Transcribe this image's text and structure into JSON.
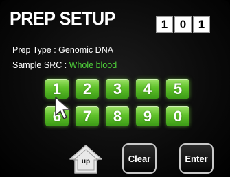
{
  "header": {
    "title": "PREP SETUP",
    "counter": [
      "1",
      "0",
      "1"
    ]
  },
  "info": {
    "prep_type_label": "Prep Type : ",
    "prep_type_value": "Genomic DNA",
    "sample_src_label": "Sample SRC : ",
    "sample_src_value": "Whole blood"
  },
  "keypad": {
    "keys": [
      "1",
      "2",
      "3",
      "4",
      "5",
      "6",
      "7",
      "8",
      "9",
      "0"
    ]
  },
  "actions": {
    "up_label": "up",
    "clear_label": "Clear",
    "enter_label": "Enter"
  },
  "colors": {
    "key_green": "#5fc12a",
    "value_green": "#4fd13a",
    "background": "#000000"
  }
}
